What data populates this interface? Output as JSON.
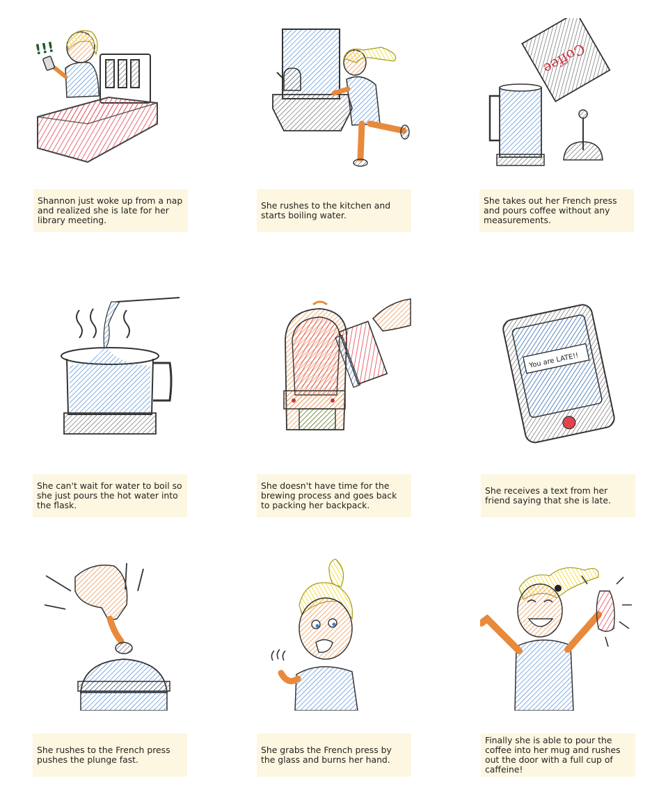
{
  "storyboard": {
    "panels": [
      {
        "caption": "Shannon just woke up from a nap and realized she is late for her library meeting.",
        "art": "girl-with-phone-on-bed"
      },
      {
        "caption": "She rushes to the kitchen and starts boiling water.",
        "art": "girl-running-to-kettle"
      },
      {
        "caption": "She takes out her French press and pours coffee without any measurements.",
        "art": "coffee-bag-and-french-press"
      },
      {
        "caption": "She can't wait for water to boil so she just pours the hot water into the flask.",
        "art": "water-pouring-into-flask"
      },
      {
        "caption": "She doesn't have time for the brewing process and goes back to packing her backpack.",
        "art": "backpack-and-book"
      },
      {
        "caption": "She receives a text from her friend saying that she is late.",
        "art": "phone-text-message"
      },
      {
        "caption": "She rushes to the French press pushes the plunge fast.",
        "art": "hand-pushing-plunger"
      },
      {
        "caption": "She grabs the French press by the glass and burns her hand.",
        "art": "girl-burned-hand"
      },
      {
        "caption": "Finally she is able to pour the coffee into her mug and rushes out the door with a full cup of caffeine!",
        "art": "girl-celebrating-with-mug"
      }
    ],
    "drawing_text": {
      "coffee_bag": "Coffee",
      "phone_message": "You are LATE!!",
      "alarm_marks": "!!!"
    },
    "colors": {
      "caption_bg": "#fdf6e1",
      "blue": "#3a7fd0",
      "red": "#e0444f",
      "orange": "#e88a3c",
      "yellow": "#f2df4a",
      "green": "#3d8a3d"
    }
  }
}
